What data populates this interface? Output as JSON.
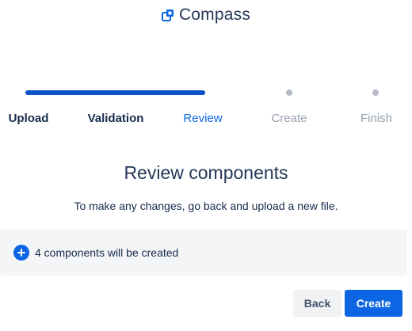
{
  "brand": {
    "name": "Compass",
    "icon": "compass-logo-icon",
    "color": "#0c66e4"
  },
  "stepper": {
    "progress_fraction": 0.5,
    "steps": [
      {
        "label": "Upload",
        "state": "done"
      },
      {
        "label": "Validation",
        "state": "done"
      },
      {
        "label": "Review",
        "state": "current"
      },
      {
        "label": "Create",
        "state": "todo"
      },
      {
        "label": "Finish",
        "state": "todo"
      }
    ]
  },
  "main": {
    "title": "Review components",
    "subtitle": "To make any changes, go back and upload a new file.",
    "info": {
      "icon": "add-circle-icon",
      "text": "4 components will be created"
    }
  },
  "actions": {
    "back_label": "Back",
    "create_label": "Create"
  },
  "colors": {
    "accent": "#0c66e4",
    "progress": "#0b52c9",
    "panel_bg": "#f4f5f7",
    "muted": "#97a0af"
  }
}
